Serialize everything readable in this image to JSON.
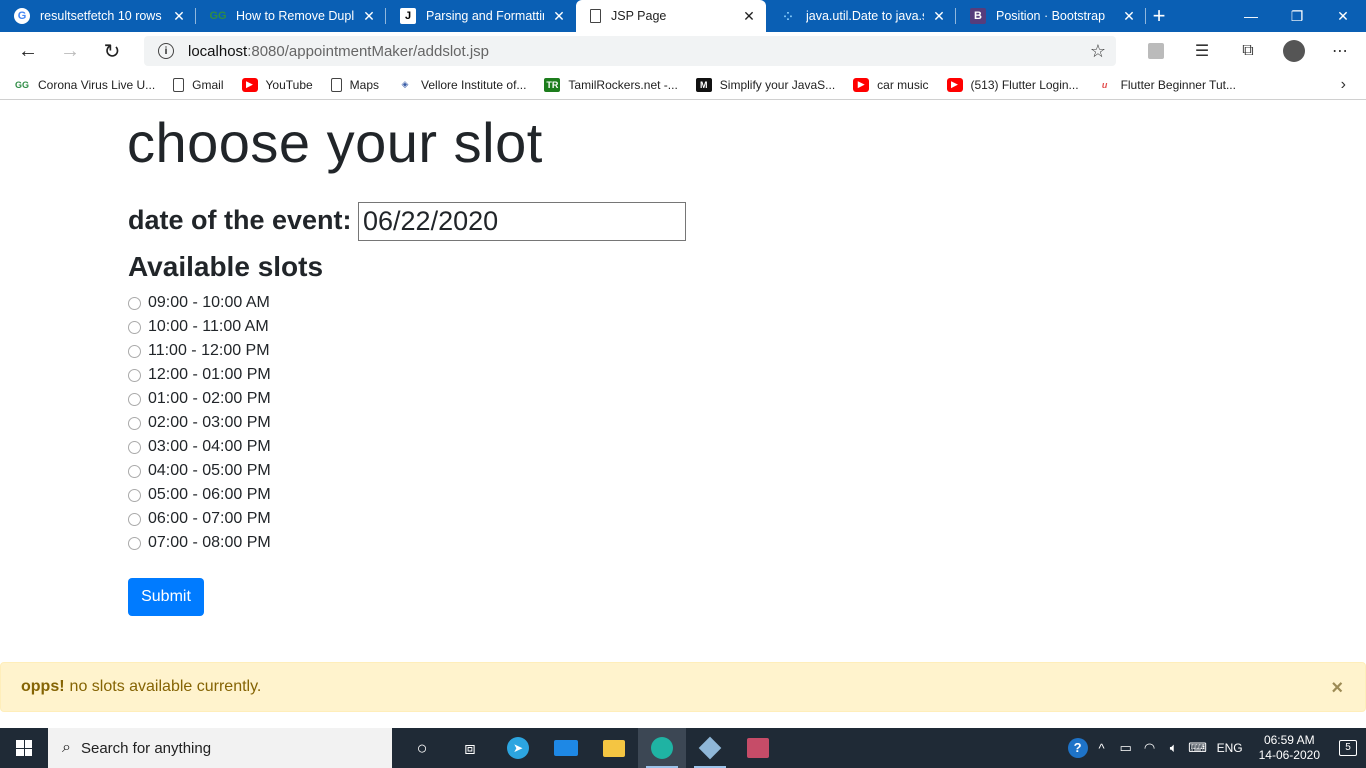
{
  "browser": {
    "tabs": [
      {
        "title": "resultsetfetch 10 rows -",
        "icon": "google-icon"
      },
      {
        "title": "How to Remove Duplic",
        "icon": "geeksforgeeks-icon"
      },
      {
        "title": "Parsing and Formatting",
        "icon": "j-icon"
      },
      {
        "title": "JSP Page",
        "icon": "page-icon"
      },
      {
        "title": "java.util.Date to java.sql",
        "icon": "loading-icon"
      },
      {
        "title": "Position · Bootstrap",
        "icon": "bootstrap-icon"
      }
    ],
    "url_host": "localhost",
    "url_path": ":8080/appointmentMaker/addslot.jsp",
    "bookmarks": [
      {
        "label": "Corona Virus Live U...",
        "icon": "gfg-icon"
      },
      {
        "label": "Gmail",
        "icon": "page-icon"
      },
      {
        "label": "YouTube",
        "icon": "youtube-icon"
      },
      {
        "label": "Maps",
        "icon": "page-icon"
      },
      {
        "label": "Vellore Institute of...",
        "icon": "vit-icon"
      },
      {
        "label": "TamilRockers.net -...",
        "icon": "tr-icon"
      },
      {
        "label": "Simplify your JavaS...",
        "icon": "medium-icon"
      },
      {
        "label": "car music",
        "icon": "youtube-icon"
      },
      {
        "label": "(513) Flutter Login...",
        "icon": "youtube-icon"
      },
      {
        "label": "Flutter Beginner Tut...",
        "icon": "udemy-icon"
      }
    ]
  },
  "page": {
    "heading": "choose your slot",
    "date_label": "date of the event:",
    "date_value": "06/22/2020",
    "slots_heading": "Available slots",
    "slots": [
      "09:00 - 10:00 AM",
      "10:00 - 11:00 AM",
      "11:00 - 12:00 PM",
      "12:00 - 01:00 PM",
      "01:00 - 02:00 PM",
      "02:00 - 03:00 PM",
      "03:00 - 04:00 PM",
      "04:00 - 05:00 PM",
      "05:00 - 06:00 PM",
      "06:00 - 07:00 PM",
      "07:00 - 08:00 PM"
    ],
    "submit_label": "Submit"
  },
  "alert": {
    "strong": "opps!",
    "message": "no slots available currently.",
    "close": "×"
  },
  "taskbar": {
    "search_placeholder": "Search for anything",
    "language": "ENG",
    "time": "06:59 AM",
    "date": "14-06-2020",
    "notifications": "5"
  },
  "colors": {
    "tabbar": "#0a5fb4",
    "primary_button": "#007bff",
    "alert_bg": "#fff3cd",
    "alert_text": "#856404"
  }
}
